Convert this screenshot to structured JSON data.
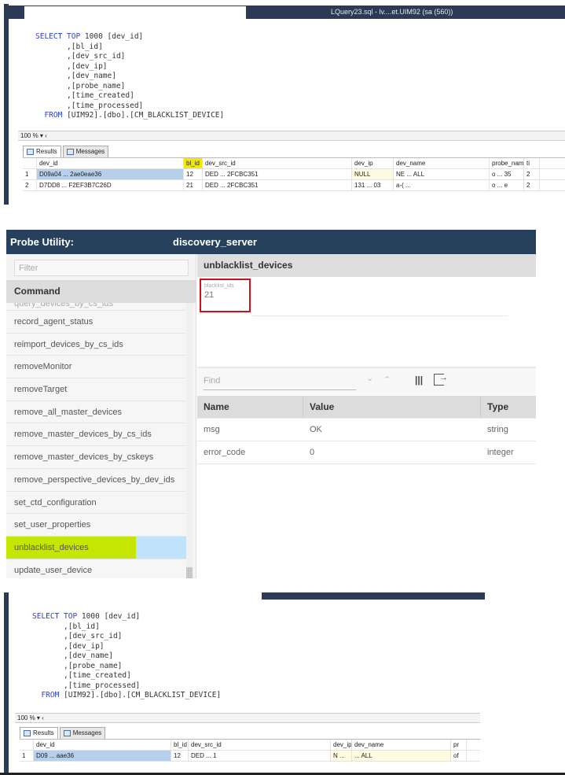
{
  "top_ssms": {
    "title": "LQuery23.sql - lv....et.UIM92 (sa (560))",
    "code": [
      {
        "kw": "SELECT TOP",
        "rest": " 1000 [dev_id]",
        "indent": ""
      },
      {
        "kw": "",
        "rest": ",[bl_id]",
        "indent": "       "
      },
      {
        "kw": "",
        "rest": ",[dev_src_id]",
        "indent": "       "
      },
      {
        "kw": "",
        "rest": ",[dev_ip]",
        "indent": "       "
      },
      {
        "kw": "",
        "rest": ",[dev_name]",
        "indent": "       "
      },
      {
        "kw": "",
        "rest": ",[probe_name]",
        "indent": "       "
      },
      {
        "kw": "",
        "rest": ",[time_created]",
        "indent": "       "
      },
      {
        "kw": "",
        "rest": ",[time_processed]",
        "indent": "       "
      },
      {
        "kw": "FROM",
        "rest": " [UIM92].[dbo].[CM_BLACKLIST_DEVICE]",
        "indent": "  "
      }
    ],
    "zoom": "100 %",
    "tabs": [
      "Results",
      "Messages"
    ],
    "columns": [
      "",
      "dev_id",
      "bl_id",
      "dev_src_id",
      "dev_ip",
      "dev_name",
      "probe_name",
      "ti"
    ],
    "rows": [
      [
        "1",
        "D09a04 ... 2ae0eae36",
        "12",
        "DED ... 2FCBC351",
        "NULL",
        "NE ... ALL",
        "o ... 35",
        "2"
      ],
      [
        "2",
        "D7DD8 ... F2EF3B7C26D",
        "21",
        "DED ... 2FCBC351",
        "131 ... 03",
        "a-( ...",
        "o ... e",
        "2"
      ]
    ]
  },
  "probe_utility": {
    "title": "Probe Utility:",
    "server": "discovery_server",
    "filter_placeholder": "Filter",
    "command_header": "Command",
    "commands": [
      "query_devices_by_cs_ids",
      "record_agent_status",
      "reimport_devices_by_cs_ids",
      "removeMonitor",
      "removeTarget",
      "remove_all_master_devices",
      "remove_master_devices_by_cs_ids",
      "remove_master_devices_by_cskeys",
      "remove_perspective_devices_by_dev_ids",
      "set_ctd_configuration",
      "set_user_properties",
      "unblacklist_devices",
      "update_user_device"
    ],
    "selected_command": "unblacklist_devices",
    "panel_title": "unblacklist_devices",
    "param_label": "blacklist_ids",
    "param_value": "21",
    "find_placeholder": "Find",
    "result_columns": [
      "Name",
      "Value",
      "Type"
    ],
    "results": [
      [
        "msg",
        "OK",
        "string"
      ],
      [
        "error_code",
        "0",
        "integer"
      ]
    ],
    "highlight_color": "#c5e600",
    "annotation_color": "#d0101a"
  },
  "bottom_ssms": {
    "code": [
      {
        "kw": "SELECT TOP",
        "rest": " 1000 [dev_id]",
        "indent": ""
      },
      {
        "kw": "",
        "rest": ",[bl_id]",
        "indent": "       "
      },
      {
        "kw": "",
        "rest": ",[dev_src_id]",
        "indent": "       "
      },
      {
        "kw": "",
        "rest": ",[dev_ip]",
        "indent": "       "
      },
      {
        "kw": "",
        "rest": ",[dev_name]",
        "indent": "       "
      },
      {
        "kw": "",
        "rest": ",[probe_name]",
        "indent": "       "
      },
      {
        "kw": "",
        "rest": ",[time_created]",
        "indent": "       "
      },
      {
        "kw": "",
        "rest": ",[time_processed]",
        "indent": "       "
      },
      {
        "kw": "FROM",
        "rest": " [UIM92].[dbo].[CM_BLACKLIST_DEVICE]",
        "indent": "  "
      }
    ],
    "zoom": "100 %",
    "tabs": [
      "Results",
      "Messages"
    ],
    "columns": [
      "",
      "dev_id",
      "bl_id",
      "dev_src_id",
      "dev_ip",
      "dev_name",
      "pr"
    ],
    "rows": [
      [
        "1",
        "D09 ... aae36",
        "12",
        "DED ... 1",
        "N ...",
        "... ALL",
        "of"
      ]
    ]
  }
}
